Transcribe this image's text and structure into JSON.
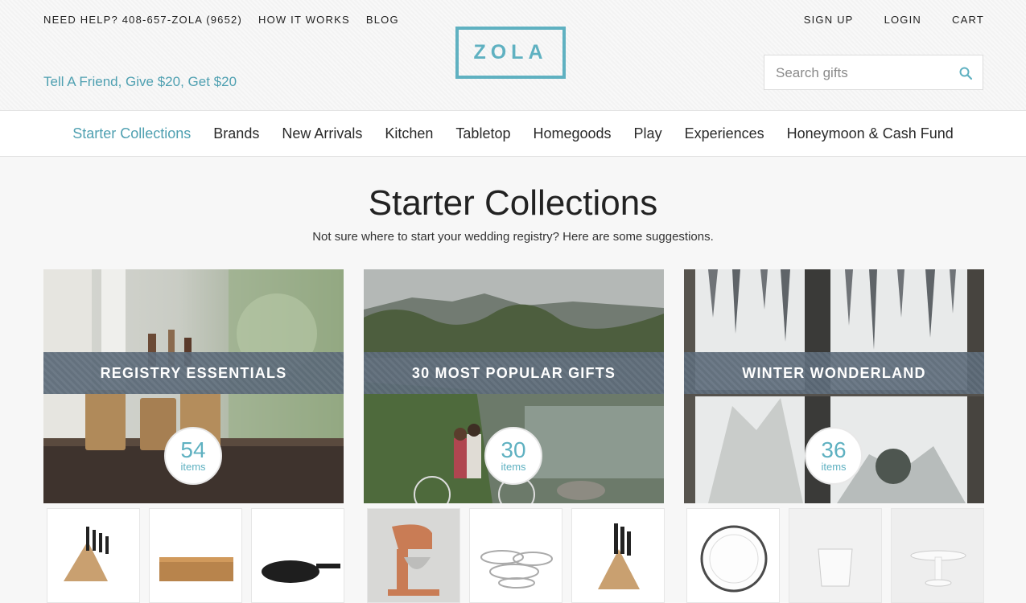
{
  "topbar": {
    "help": "NEED HELP? 408-657-ZOLA (9652)",
    "how_it_works": "HOW IT WORKS",
    "blog": "BLOG",
    "sign_up": "SIGN UP",
    "login": "LOGIN",
    "cart": "CART"
  },
  "promo": "Tell A Friend, Give $20, Get $20",
  "logo": "ZOLA",
  "search": {
    "placeholder": "Search gifts",
    "icon": "search-icon"
  },
  "nav": [
    "Starter Collections",
    "Brands",
    "New Arrivals",
    "Kitchen",
    "Tabletop",
    "Homegoods",
    "Play",
    "Experiences",
    "Honeymoon & Cash Fund"
  ],
  "page": {
    "title": "Starter Collections",
    "subtitle": "Not sure where to start your wedding registry? Here are some suggestions."
  },
  "collections": [
    {
      "title": "REGISTRY ESSENTIALS",
      "count": "54",
      "count_label": "items"
    },
    {
      "title": "30 MOST POPULAR GIFTS",
      "count": "30",
      "count_label": "items"
    },
    {
      "title": "WINTER WONDERLAND",
      "count": "36",
      "count_label": "items"
    }
  ],
  "colors": {
    "accent": "#5fb1c1",
    "band": "#5d6b78"
  }
}
